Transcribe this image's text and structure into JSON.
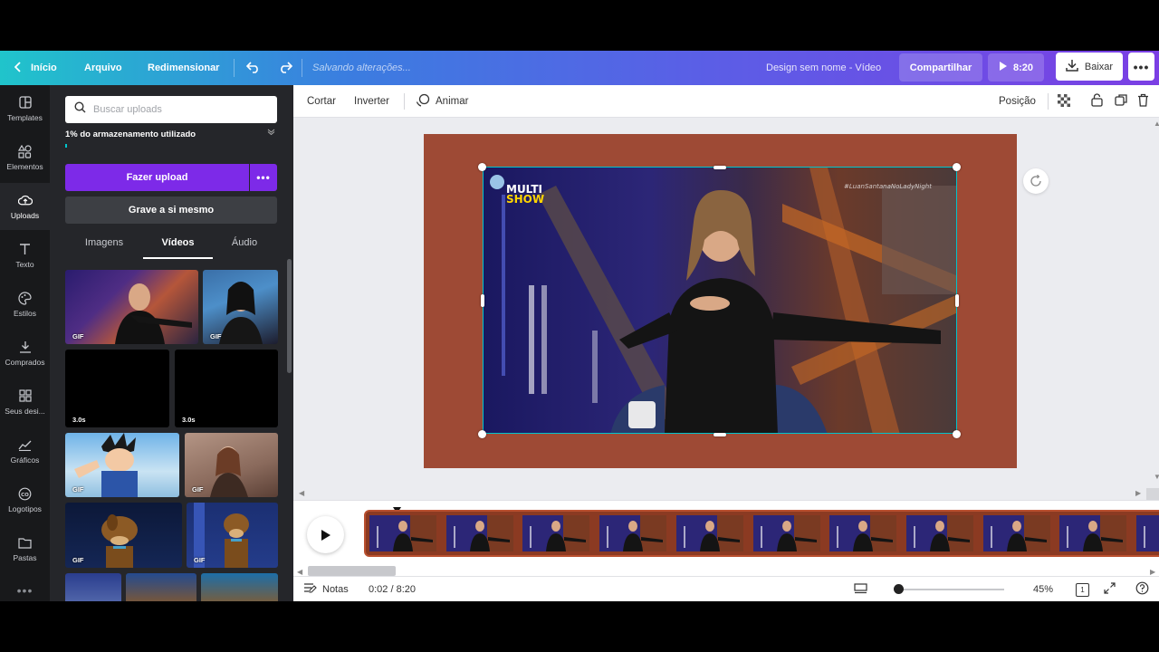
{
  "topbar": {
    "home": "Início",
    "file": "Arquivo",
    "resize": "Redimensionar",
    "saving": "Salvando alterações...",
    "design_name": "Design sem nome - Vídeo",
    "share": "Compartilhar",
    "duration": "8:20",
    "download": "Baixar",
    "gradient": [
      "#20c4cb",
      "#3b7de0",
      "#7b3fe4"
    ]
  },
  "rail": {
    "items": [
      {
        "label": "Templates",
        "icon": "layout-icon"
      },
      {
        "label": "Elementos",
        "icon": "shapes-icon"
      },
      {
        "label": "Uploads",
        "icon": "cloud-upload-icon"
      },
      {
        "label": "Texto",
        "icon": "text-icon"
      },
      {
        "label": "Estilos",
        "icon": "palette-icon"
      },
      {
        "label": "Comprados",
        "icon": "download-icon"
      },
      {
        "label": "Seus desi...",
        "icon": "grid-icon"
      },
      {
        "label": "Gráficos",
        "icon": "chart-icon"
      },
      {
        "label": "Logotipos",
        "icon": "logo-icon"
      },
      {
        "label": "Pastas",
        "icon": "folder-icon"
      }
    ],
    "active": "Uploads"
  },
  "panel": {
    "search_placeholder": "Buscar uploads",
    "storage": "1% do armazenamento utilizado",
    "storage_percent": 1,
    "upload_button": "Fazer upload",
    "record_button": "Grave a si mesmo",
    "tabs": [
      "Imagens",
      "Vídeos",
      "Áudio"
    ],
    "active_tab": "Vídeos",
    "thumbs": [
      {
        "label": "GIF"
      },
      {
        "label": "GIF"
      },
      {
        "label": "3.0s"
      },
      {
        "label": "3.0s"
      },
      {
        "label": "GIF"
      },
      {
        "label": "GIF"
      },
      {
        "label": "GIF"
      },
      {
        "label": "GIF"
      }
    ]
  },
  "ctxbar": {
    "crop": "Cortar",
    "flip": "Inverter",
    "animate": "Animar",
    "position": "Posição"
  },
  "canvas": {
    "page_color": "#9e4a35",
    "logo_text": "MULTI SHOW",
    "hashtag": "#LuanSantanaNoLadyNight"
  },
  "timeline": {
    "frame_count": 11
  },
  "bottombar": {
    "notes": "Notas",
    "time": "0:02 / 8:20",
    "zoom": "45%",
    "page_count": "1"
  },
  "colors": {
    "accent": "#7d2ae8",
    "selection": "#00c4cc",
    "rail_bg": "#18191b",
    "panel_bg": "#25262a"
  }
}
